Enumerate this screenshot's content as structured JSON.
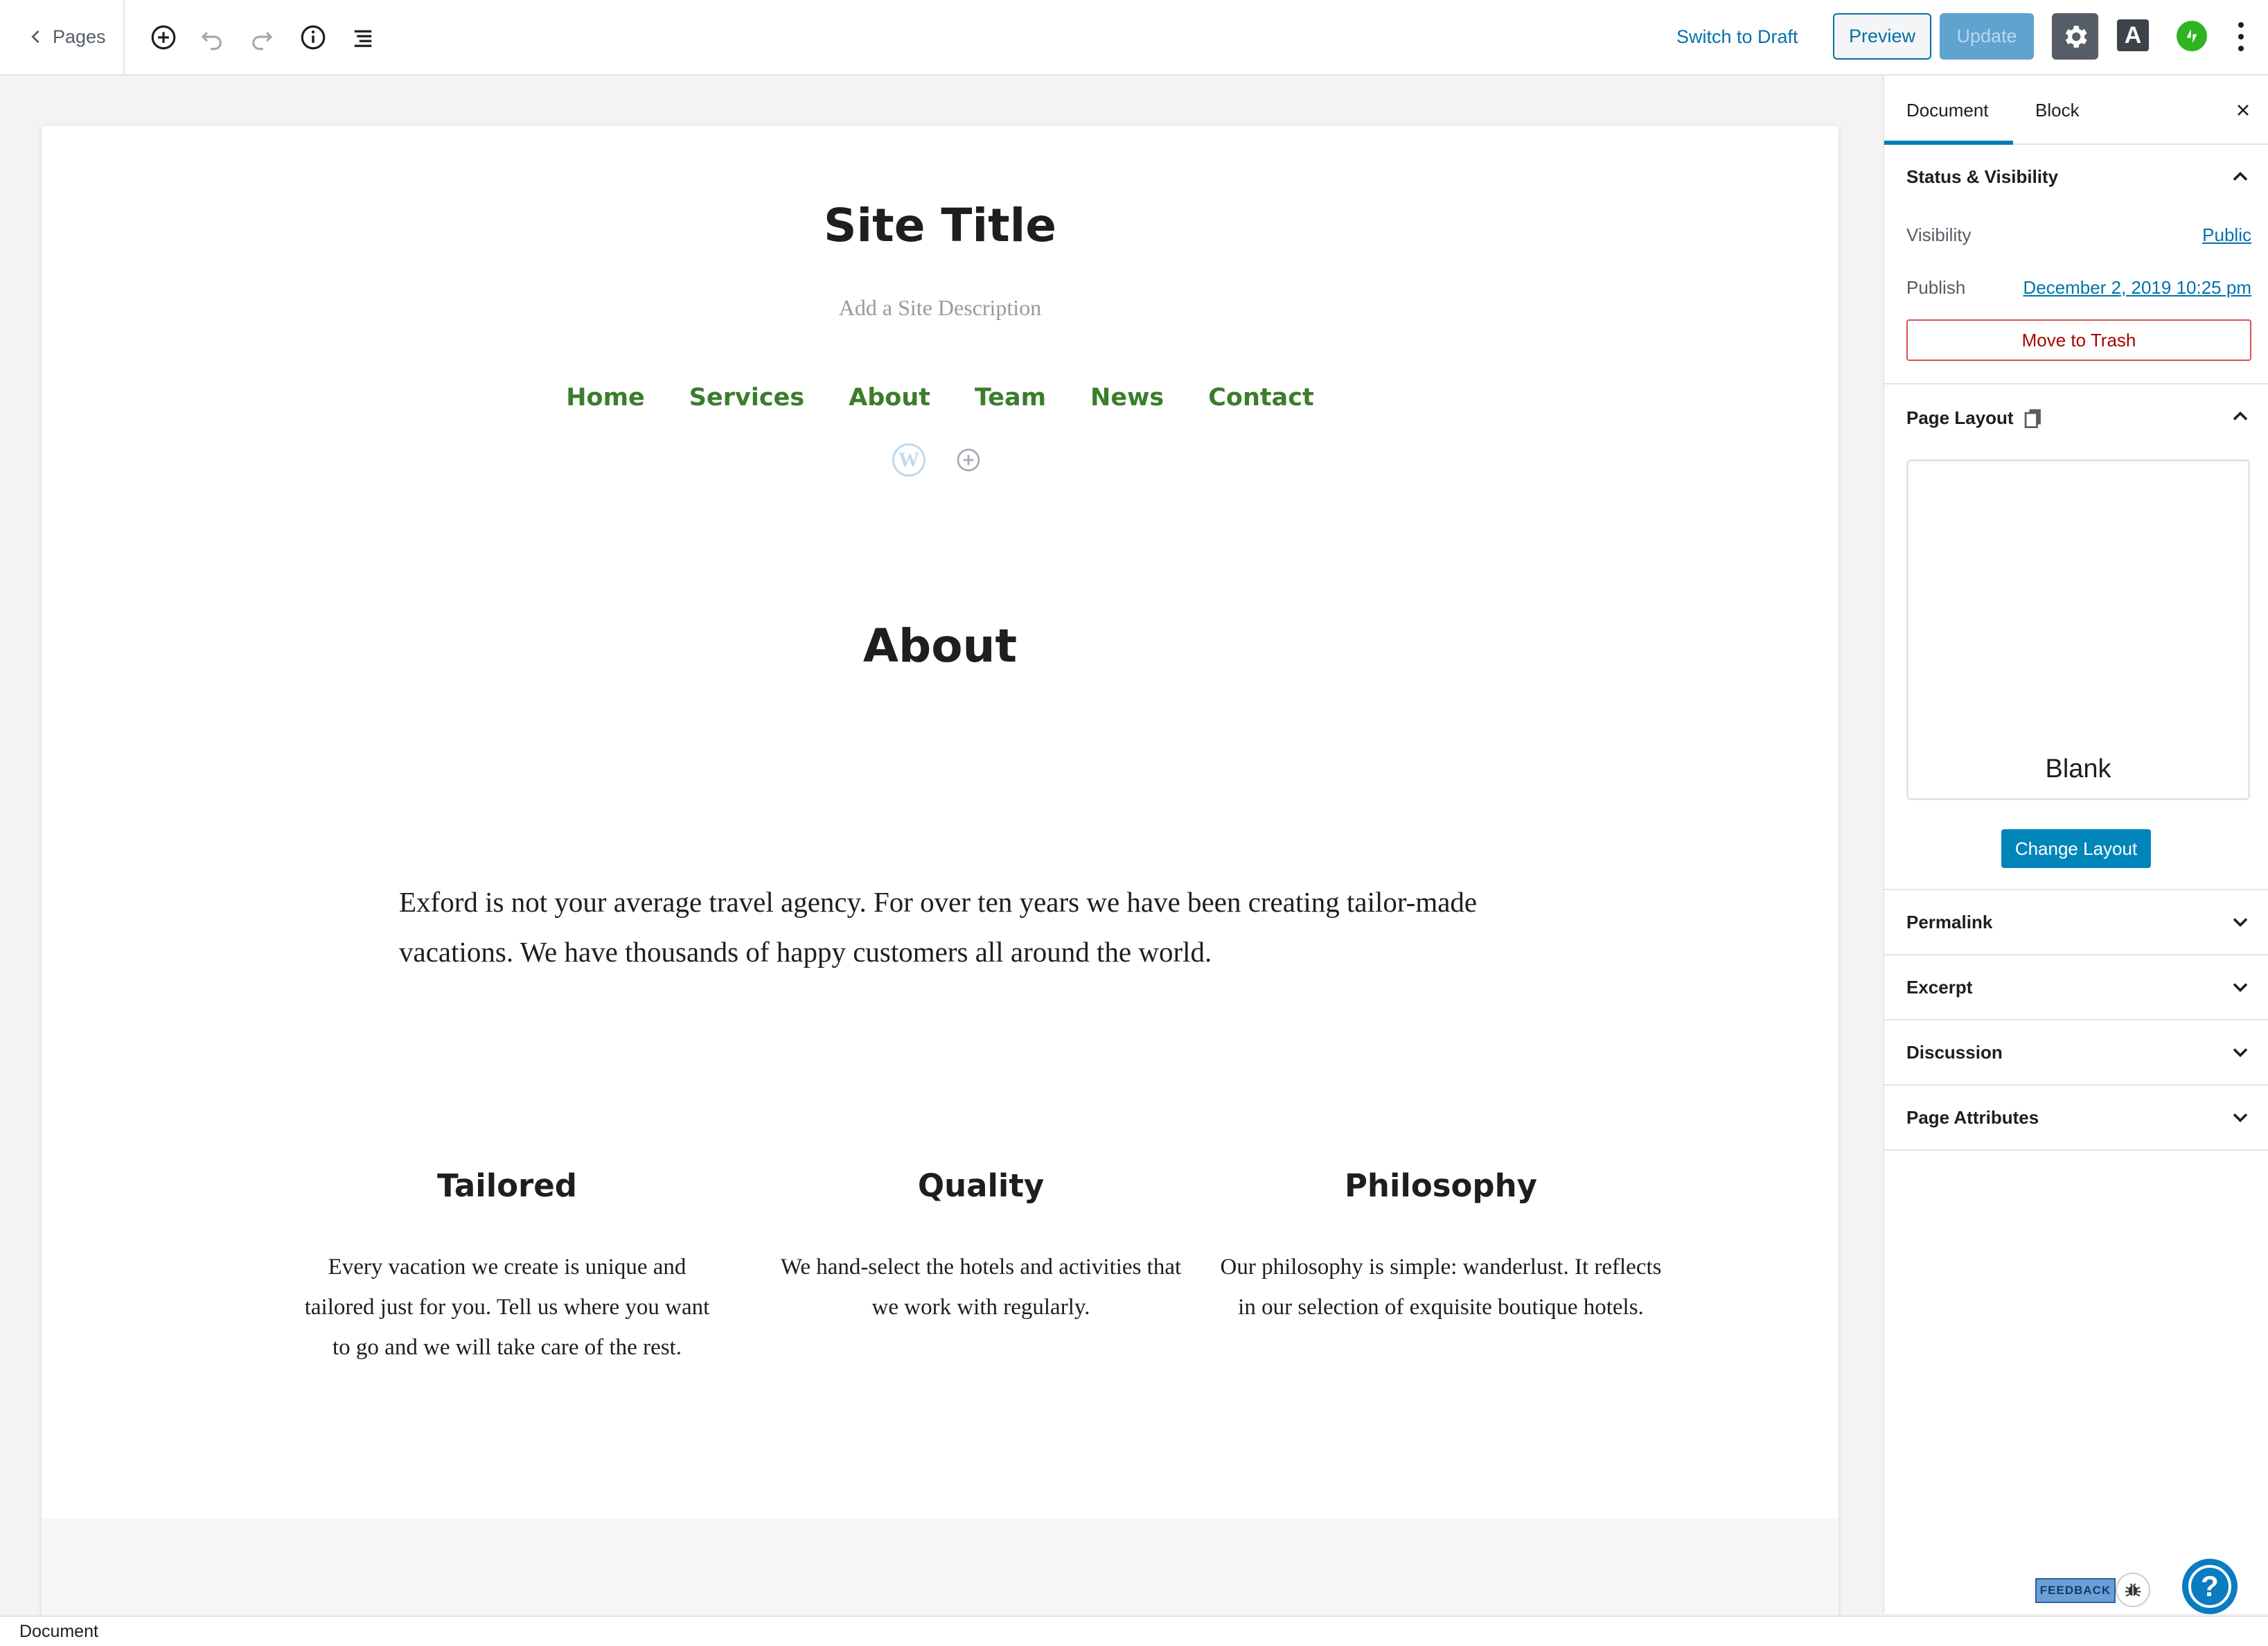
{
  "topbar": {
    "back_label": "Pages",
    "switch_draft_label": "Switch to Draft",
    "preview_label": "Preview",
    "update_label": "Update",
    "font_button_label": "A",
    "icons": [
      "plus-circle-icon",
      "undo-icon",
      "redo-icon",
      "info-icon",
      "list-view-icon",
      "gear-icon",
      "jetpack-icon",
      "more-vertical-icon"
    ]
  },
  "site": {
    "title": "Site Title",
    "description": "Add a Site Description",
    "nav": [
      "Home",
      "Services",
      "About",
      "Team",
      "News",
      "Contact"
    ]
  },
  "content": {
    "heading": "About",
    "paragraph": "Exford is not your average travel agency. For over ten years we have been creating tailor-made vacations. We have thousands of happy customers all around the world.",
    "columns": [
      {
        "title": "Tailored",
        "text": "Every vacation we create is unique and tailored just for you. Tell us where you want to go and we will take care of the rest."
      },
      {
        "title": "Quality",
        "text": "We hand-select the hotels and activities that we work with regularly."
      },
      {
        "title": "Philosophy",
        "text": "Our philosophy is simple: wanderlust. It reflects in our selection of exquisite boutique hotels."
      }
    ]
  },
  "sidebar": {
    "tabs": [
      "Document",
      "Block"
    ],
    "status": {
      "title": "Status & Visibility",
      "visibility_label": "Visibility",
      "visibility_value": "Public",
      "publish_label": "Publish",
      "publish_value": "December 2, 2019 10:25 pm",
      "trash_label": "Move to Trash"
    },
    "layout": {
      "title": "Page Layout",
      "current": "Blank",
      "change_label": "Change Layout"
    },
    "panels": [
      "Permalink",
      "Excerpt",
      "Discussion",
      "Page Attributes"
    ]
  },
  "widgets": {
    "feedback_label": "FEEDBACK",
    "help_label": "?"
  },
  "statusbar": {
    "label": "Document"
  },
  "colors": {
    "accent": "#0073aa",
    "nav_green": "#3a7d2b",
    "update_disabled": "#5fa3ce",
    "trash_red": "#a00"
  }
}
